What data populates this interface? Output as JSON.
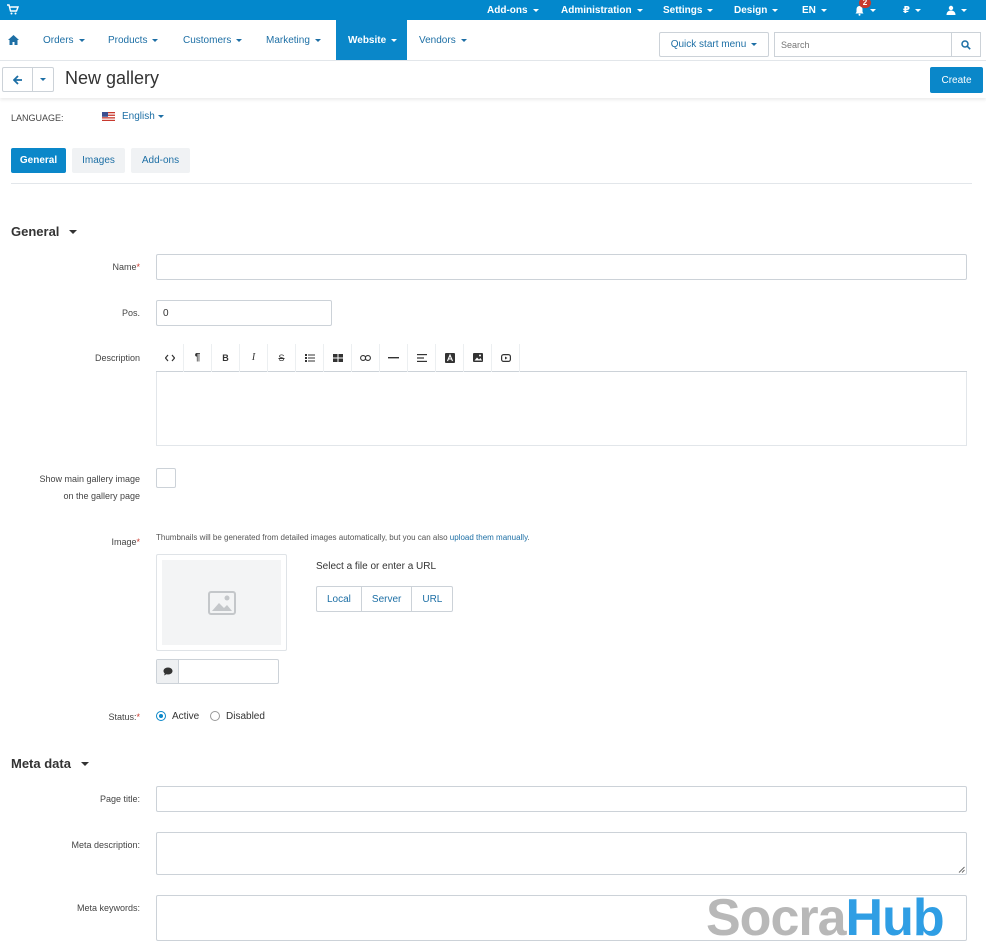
{
  "topbar": {
    "menu": [
      {
        "label": "Add-ons",
        "icon": "chevron-down-icon"
      },
      {
        "label": "Administration",
        "icon": "chevron-down-icon"
      },
      {
        "label": "Settings",
        "icon": "chevron-down-icon"
      },
      {
        "label": "Design",
        "icon": "chevron-down-icon"
      },
      {
        "label": "EN",
        "icon": "chevron-down-icon"
      },
      {
        "label": "₽",
        "icon": "chevron-down-icon"
      }
    ],
    "notifications_count": "2",
    "icons": [
      "cart-icon",
      "bell-icon",
      "user-icon"
    ]
  },
  "navbar": {
    "items": [
      "Orders",
      "Products",
      "Customers",
      "Marketing",
      "Website",
      "Vendors"
    ],
    "active": "Website",
    "quick_start": "Quick start menu",
    "search_placeholder": "Search"
  },
  "titlebar": {
    "title": "New gallery",
    "create_label": "Create"
  },
  "language": {
    "label": "LANGUAGE:",
    "value": "English"
  },
  "tabs": [
    "General",
    "Images",
    "Add-ons"
  ],
  "general": {
    "heading": "General",
    "name_label": "Name",
    "name_value": "",
    "pos_label": "Pos.",
    "pos_value": "0",
    "description_label": "Description",
    "toolbar": [
      "code-view-icon",
      "paragraph-icon",
      "bold-icon",
      "italic-icon",
      "strikethrough-icon",
      "list-icon",
      "table-icon",
      "link-icon",
      "horizontal-rule-icon",
      "align-icon",
      "font-color-icon",
      "image-icon",
      "video-icon"
    ],
    "show_main_label_1": "Show main gallery image",
    "show_main_label_2": "on the gallery page",
    "image_label": "Image",
    "image_hint": "Thumbnails will be generated from detailed images automatically, but you can also ",
    "image_hint_link": "upload them manually",
    "image_hint_end": ".",
    "select_label": "Select a file or enter a URL",
    "sources": [
      "Local",
      "Server",
      "URL"
    ],
    "status_label": "Status:",
    "status_options": [
      "Active",
      "Disabled"
    ],
    "status_selected": "Active"
  },
  "meta": {
    "heading": "Meta data",
    "page_title_label": "Page title:",
    "meta_description_label": "Meta description:",
    "meta_keywords_label": "Meta keywords:"
  },
  "watermark": {
    "part1": "Socra",
    "part2": "Hub"
  },
  "colors": {
    "topbar": "#0388cc",
    "accent": "#0a87c9",
    "link": "#1d6fa5",
    "required": "#c8392e"
  }
}
